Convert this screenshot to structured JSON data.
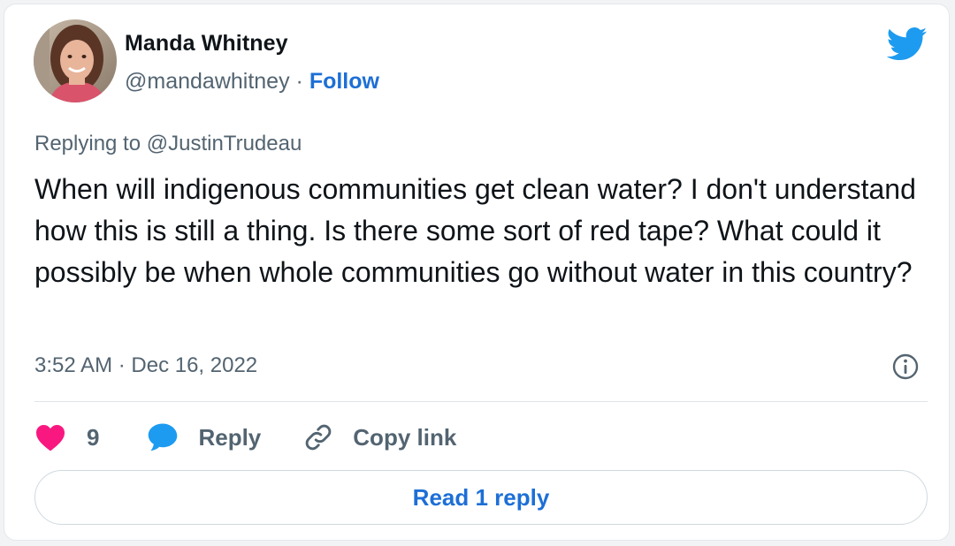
{
  "tweet": {
    "author": {
      "name": "Manda Whitney",
      "handle": "@mandawhitney",
      "separator": " · ",
      "follow_label": "Follow"
    },
    "replying_prefix": "Replying to ",
    "replying_to": "@JustinTrudeau",
    "text": "When will indigenous communities get clean water? I don't understand how this is still a thing. Is there some sort of red tape? What could it possibly be when whole communities go without water in this country?",
    "timestamp": "3:52 AM · Dec 16, 2022"
  },
  "actions": {
    "like_count": "9",
    "reply_label": "Reply",
    "copy_link_label": "Copy link"
  },
  "read_replies_label": "Read 1 reply",
  "icons": {
    "brand": "twitter-bird-icon",
    "info": "info-icon",
    "like": "heart-icon",
    "reply": "speech-bubble-icon",
    "copy": "link-icon"
  },
  "colors": {
    "twitter_blue": "#1d9bf0",
    "link_blue": "#1d6fd6",
    "like_pink": "#f91880",
    "text_dark": "#0f1419",
    "text_muted": "#536471"
  }
}
